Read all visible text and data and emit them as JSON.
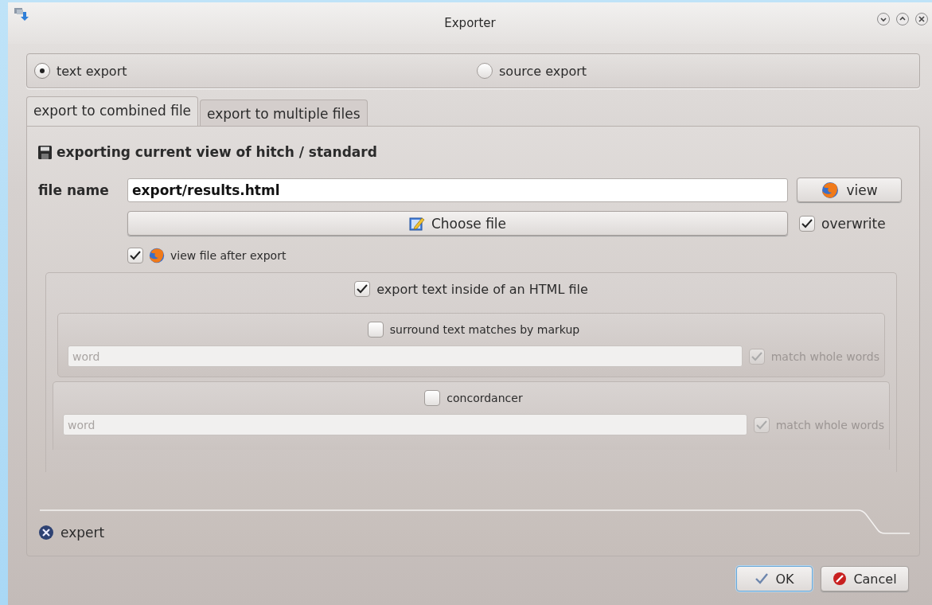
{
  "window": {
    "title": "Exporter"
  },
  "radio_options": [
    {
      "label": "text export",
      "selected": true
    },
    {
      "label": "source export",
      "selected": false
    }
  ],
  "tabs": [
    {
      "label": "export to combined file",
      "selected": true
    },
    {
      "label": "export to multiple files",
      "selected": false
    }
  ],
  "heading": "exporting current view of hitch / standard",
  "file_name": {
    "label": "file name",
    "value": "export/results.html"
  },
  "view_button": "view",
  "choose_file_button": "Choose file",
  "overwrite": {
    "label": "overwrite",
    "checked": true
  },
  "view_after_export": {
    "label": "view file after export",
    "checked": true
  },
  "html_group": {
    "label": "export text inside of an HTML file",
    "checked": true,
    "subgroups": [
      {
        "label": "surround text matches by markup",
        "checked": false,
        "placeholder": "word",
        "match_whole_words": {
          "label": "match whole words",
          "checked": true
        },
        "disabled": true
      },
      {
        "label": "concordancer",
        "checked": false,
        "placeholder": "word",
        "match_whole_words": {
          "label": "match whole words",
          "checked": true
        },
        "disabled": true
      }
    ]
  },
  "expert": "expert",
  "buttons": [
    {
      "label": "OK",
      "kind": "ok"
    },
    {
      "label": "Cancel",
      "kind": "cancel"
    }
  ]
}
